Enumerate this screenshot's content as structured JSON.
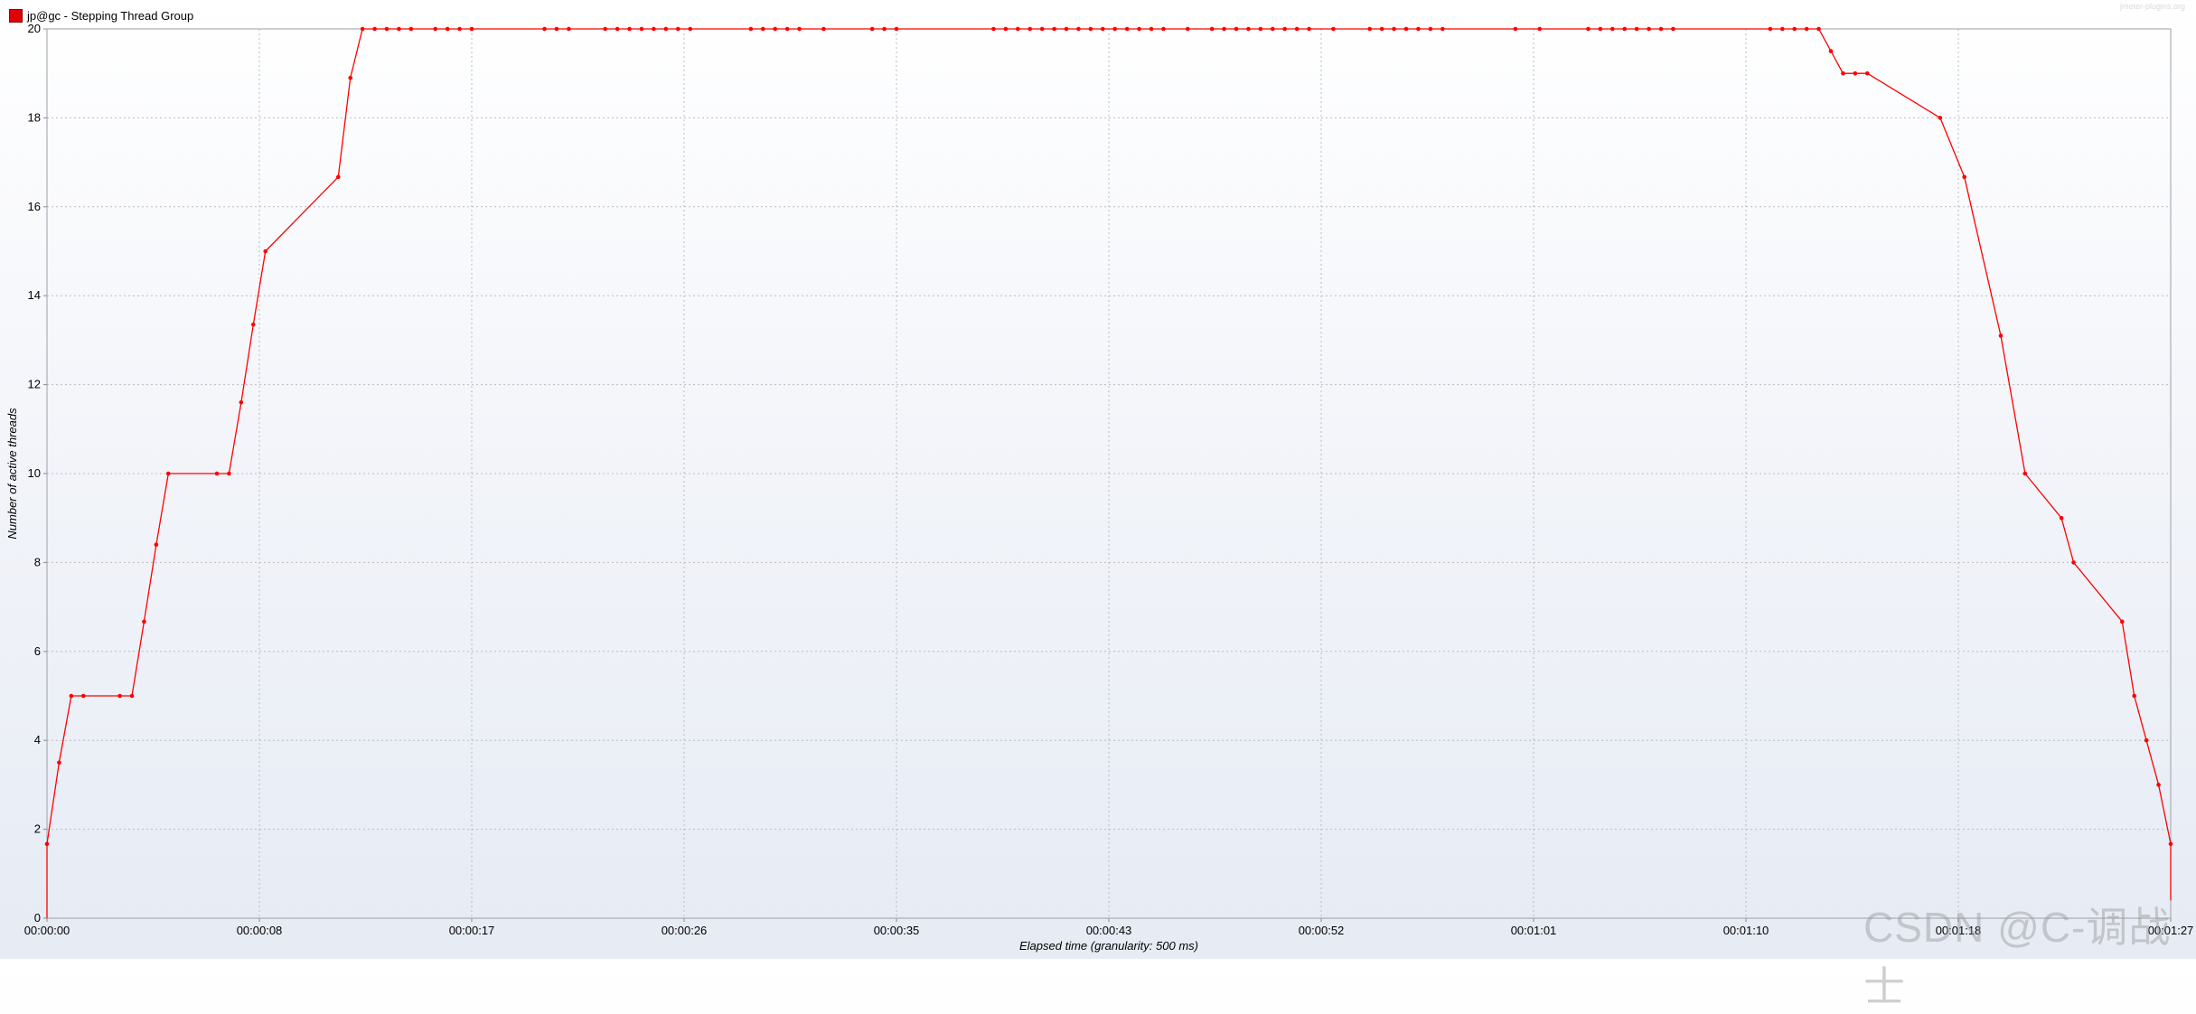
{
  "legend": {
    "label": "jp@gc - Stepping Thread Group",
    "color": "#e00000"
  },
  "watermarks": {
    "site": "jmeter-plugins.org",
    "csdn": "CSDN @C-调战士"
  },
  "chart_data": {
    "type": "line",
    "xlabel": "Elapsed time (granularity: 500 ms)",
    "ylabel": "Number of active threads",
    "xlim": [
      0,
      87.5
    ],
    "ylim": [
      0,
      20
    ],
    "yticks": [
      0,
      2,
      4,
      6,
      8,
      10,
      12,
      14,
      16,
      18,
      20
    ],
    "xticks": [
      {
        "t": 0,
        "label": "00:00:00"
      },
      {
        "t": 8.75,
        "label": "00:00:08"
      },
      {
        "t": 17.5,
        "label": "00:00:17"
      },
      {
        "t": 26.25,
        "label": "00:00:26"
      },
      {
        "t": 35,
        "label": "00:00:35"
      },
      {
        "t": 43.75,
        "label": "00:00:43"
      },
      {
        "t": 52.5,
        "label": "00:00:52"
      },
      {
        "t": 61.25,
        "label": "00:01:01"
      },
      {
        "t": 70,
        "label": "00:01:10"
      },
      {
        "t": 78.75,
        "label": "00:01:18"
      },
      {
        "t": 87.5,
        "label": "00:01:27"
      }
    ],
    "grid": true,
    "series": [
      {
        "name": "jp@gc - Stepping Thread Group",
        "color": "#ff0000",
        "points": [
          [
            0,
            0
          ],
          [
            0,
            1.67
          ],
          [
            0.5,
            3.5
          ],
          [
            1,
            5
          ],
          [
            1.5,
            5
          ],
          [
            3,
            5
          ],
          [
            3.5,
            5
          ],
          [
            4,
            6.67
          ],
          [
            4.5,
            8.4
          ],
          [
            5,
            10
          ],
          [
            7,
            10
          ],
          [
            7.5,
            10
          ],
          [
            8,
            11.6
          ],
          [
            8.5,
            13.35
          ],
          [
            9,
            15
          ],
          [
            12,
            16.67
          ],
          [
            12.5,
            18.9
          ],
          [
            13,
            20
          ],
          [
            13.5,
            20
          ],
          [
            14,
            20
          ],
          [
            14.5,
            20
          ],
          [
            15,
            20
          ],
          [
            16,
            20
          ],
          [
            16.5,
            20
          ],
          [
            17,
            20
          ],
          [
            17.5,
            20
          ],
          [
            20.5,
            20
          ],
          [
            21,
            20
          ],
          [
            21.5,
            20
          ],
          [
            23,
            20
          ],
          [
            23.5,
            20
          ],
          [
            24,
            20
          ],
          [
            24.5,
            20
          ],
          [
            25,
            20
          ],
          [
            25.5,
            20
          ],
          [
            26,
            20
          ],
          [
            26.5,
            20
          ],
          [
            29,
            20
          ],
          [
            29.5,
            20
          ],
          [
            30,
            20
          ],
          [
            30.5,
            20
          ],
          [
            31,
            20
          ],
          [
            32,
            20
          ],
          [
            34,
            20
          ],
          [
            34.5,
            20
          ],
          [
            35,
            20
          ],
          [
            39,
            20
          ],
          [
            39.5,
            20
          ],
          [
            40,
            20
          ],
          [
            40.5,
            20
          ],
          [
            41,
            20
          ],
          [
            41.5,
            20
          ],
          [
            42,
            20
          ],
          [
            42.5,
            20
          ],
          [
            43,
            20
          ],
          [
            43.5,
            20
          ],
          [
            44,
            20
          ],
          [
            44.5,
            20
          ],
          [
            45,
            20
          ],
          [
            45.5,
            20
          ],
          [
            46,
            20
          ],
          [
            47,
            20
          ],
          [
            48,
            20
          ],
          [
            48.5,
            20
          ],
          [
            49,
            20
          ],
          [
            49.5,
            20
          ],
          [
            50,
            20
          ],
          [
            50.5,
            20
          ],
          [
            51,
            20
          ],
          [
            51.5,
            20
          ],
          [
            52,
            20
          ],
          [
            53,
            20
          ],
          [
            54.5,
            20
          ],
          [
            55,
            20
          ],
          [
            55.5,
            20
          ],
          [
            56,
            20
          ],
          [
            56.5,
            20
          ],
          [
            57,
            20
          ],
          [
            57.5,
            20
          ],
          [
            60.5,
            20
          ],
          [
            61.5,
            20
          ],
          [
            63.5,
            20
          ],
          [
            64,
            20
          ],
          [
            64.5,
            20
          ],
          [
            65,
            20
          ],
          [
            65.5,
            20
          ],
          [
            66,
            20
          ],
          [
            66.5,
            20
          ],
          [
            67,
            20
          ],
          [
            71,
            20
          ],
          [
            71.5,
            20
          ],
          [
            72,
            20
          ],
          [
            72.5,
            20
          ],
          [
            73,
            20
          ],
          [
            73.5,
            19.5
          ],
          [
            74,
            19
          ],
          [
            74.5,
            19
          ],
          [
            75,
            19
          ],
          [
            78,
            18
          ],
          [
            79,
            16.67
          ],
          [
            80.5,
            13.1
          ],
          [
            81.5,
            10
          ],
          [
            83,
            9
          ],
          [
            83.5,
            8
          ],
          [
            85.5,
            6.67
          ],
          [
            86,
            5
          ],
          [
            86.5,
            4
          ],
          [
            87,
            3
          ],
          [
            87.5,
            1.67
          ],
          [
            87.5,
            0.4
          ]
        ]
      }
    ]
  }
}
